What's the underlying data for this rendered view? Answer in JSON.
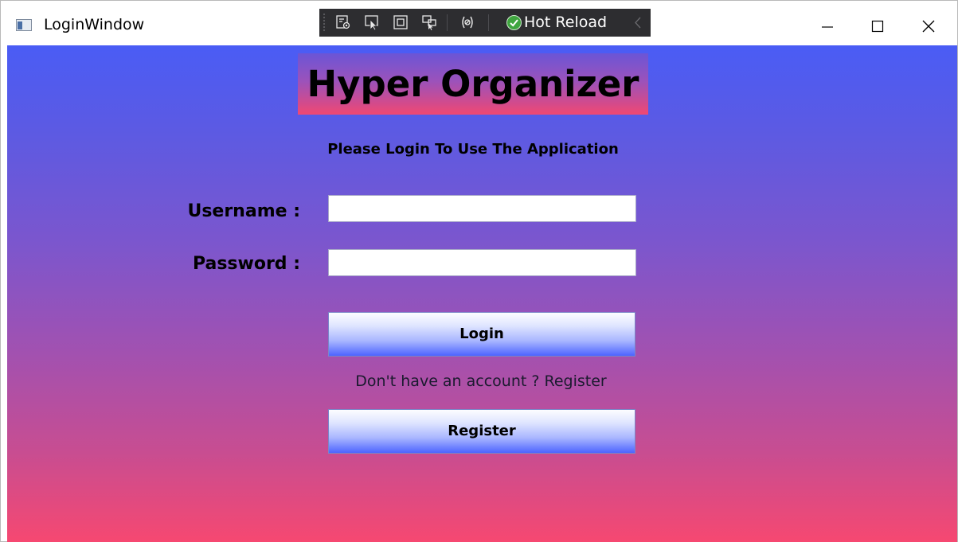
{
  "window": {
    "title": "LoginWindow",
    "icon": "wpf-window-icon"
  },
  "debug_toolbar": {
    "hot_reload_label": "Hot Reload",
    "icons": [
      "go-to-live-visual-tree-icon",
      "select-element-icon",
      "display-layout-adorners-icon",
      "track-focused-element-icon",
      "binding-failures-icon",
      "hot-reload-status-icon",
      "collapse-toolbar-icon"
    ]
  },
  "caption_buttons": [
    "minimize-icon",
    "maximize-icon",
    "close-icon"
  ],
  "colors": {
    "background_top": "#4a5cf5",
    "background_bottom": "#f64871",
    "button_gradient_bottom": "#4d64ff"
  },
  "login_form": {
    "heading": "Hyper Organizer",
    "subtitle": "Please Login To Use The Application",
    "username_label": "Username :",
    "username_value": "",
    "password_label": "Password :",
    "password_value": "",
    "login_button": "Login",
    "register_prompt": "Don't have an account ? Register",
    "register_button": "Register"
  }
}
